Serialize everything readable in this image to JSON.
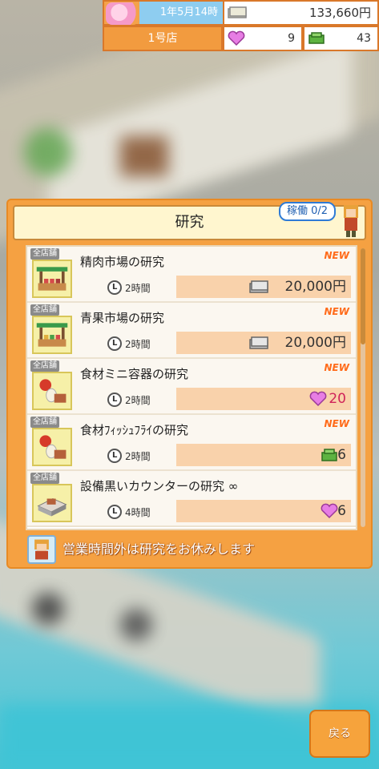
{
  "hud": {
    "date": "1年5月14時",
    "money": "133,660円",
    "store": "1号店",
    "hearts": "9",
    "gems": "43"
  },
  "panel": {
    "title": "研究",
    "status": "稼働 0/2",
    "footer_text": "営業時間外は研究をお休みします"
  },
  "research_items": [
    {
      "badge": "全店舗",
      "name": "精肉市場の研究",
      "new_label": "NEW",
      "time": "2時間",
      "cost": "20,000円",
      "cost_type": "money"
    },
    {
      "badge": "全店舗",
      "name": "青果市場の研究",
      "new_label": "NEW",
      "time": "2時間",
      "cost": "20,000円",
      "cost_type": "money"
    },
    {
      "badge": "全店舗",
      "name": "食材ミニ容器の研究",
      "new_label": "NEW",
      "time": "2時間",
      "cost": "20",
      "cost_type": "heart"
    },
    {
      "badge": "全店舗",
      "name": "食材ﾌｨｯｼｭﾌﾗｲの研究",
      "new_label": "NEW",
      "time": "2時間",
      "cost": "6",
      "cost_type": "gem"
    },
    {
      "badge": "全店舗",
      "name": "設備黒いカウンターの研究 ∞",
      "new_label": "",
      "time": "4時間",
      "cost": "6",
      "cost_type": "heart"
    }
  ],
  "clock_glyph": "L",
  "buttons": {
    "back": "戻る"
  },
  "colors": {
    "accent": "#f5a142",
    "cost_bg": "#f9d2ab",
    "new": "#ff6b1a",
    "heart_cost": "#d0245a"
  }
}
